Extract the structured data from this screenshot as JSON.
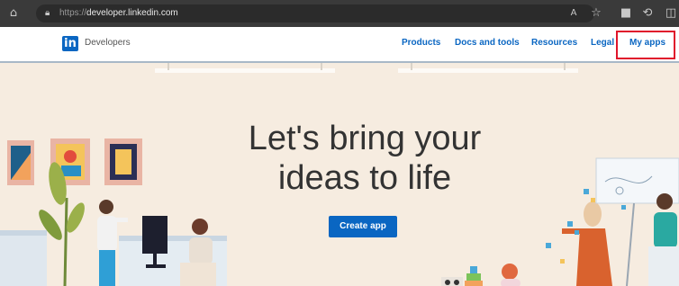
{
  "browser": {
    "url_protocol": "https://",
    "url_host": "developer.linkedin.com",
    "icons": [
      "home-icon",
      "lock-icon",
      "read-aloud-icon",
      "favorite-star-icon",
      "collections-icon",
      "extensions-icon",
      "split-screen-icon"
    ]
  },
  "header": {
    "logo_text": "in",
    "brand": "Developers",
    "nav": [
      "Products",
      "Docs and tools",
      "Resources",
      "Legal",
      "My apps"
    ],
    "accent_color": "#0a66c2",
    "highlight_color": "#e0152b"
  },
  "hero": {
    "title_line1": "Let's bring your",
    "title_line2": "ideas to life",
    "cta_label": "Create app"
  }
}
